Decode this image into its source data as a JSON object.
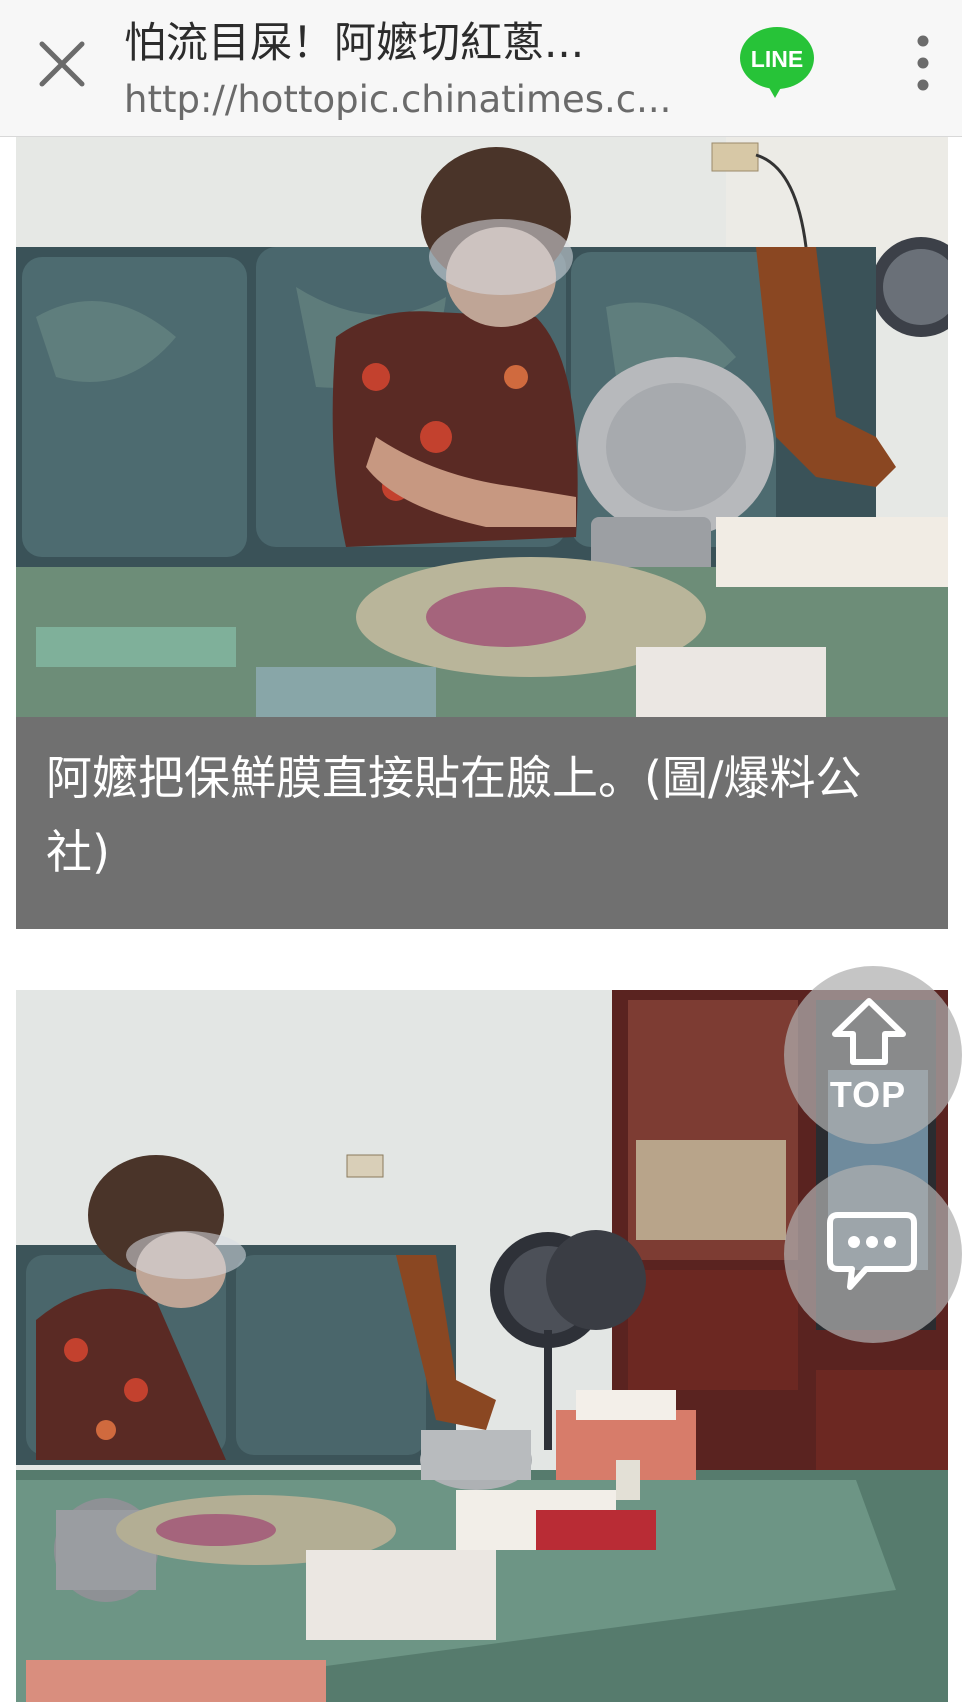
{
  "browser": {
    "title": "怕流目屎！阿嬤切紅蔥...",
    "url": "http://hottopic.chinatimes.c...",
    "line_label": "LINE"
  },
  "article": {
    "caption": "阿嬤把保鮮膜直接貼在臉上。(圖/爆料公社)"
  },
  "floating": {
    "top_label": "TOP"
  },
  "colors": {
    "line_green": "#27c338",
    "caption_bg": "#707070"
  },
  "icons": [
    "close-icon",
    "line-icon",
    "more-vertical-icon",
    "arrow-up-icon",
    "chat-bubble-icon"
  ]
}
